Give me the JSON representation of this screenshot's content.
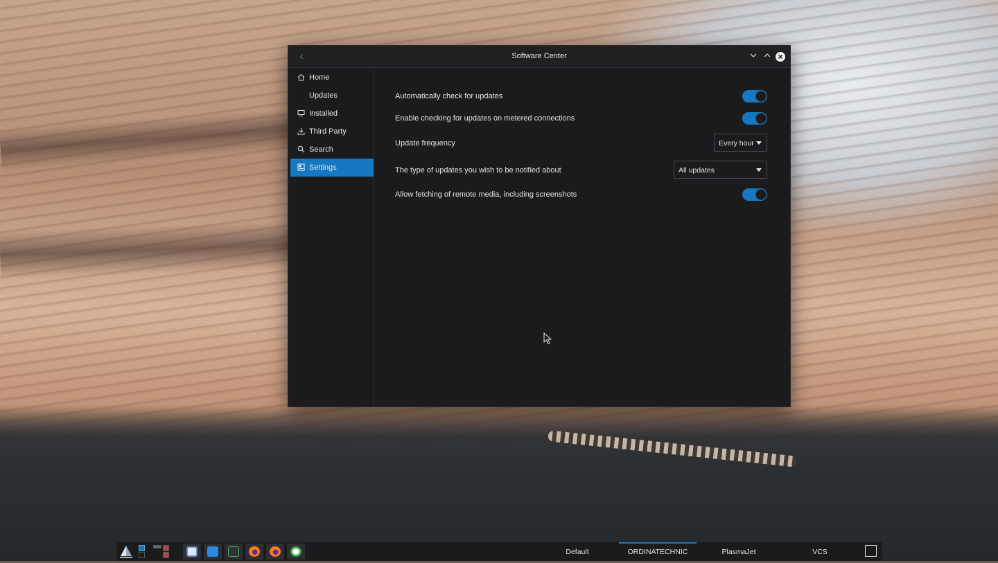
{
  "window": {
    "title": "Software Center",
    "back_icon": "chevron-left-icon",
    "controls": {
      "minimize": "chevron-down-icon",
      "maximize": "chevron-up-icon",
      "close": "close-icon"
    }
  },
  "sidebar": {
    "items": [
      {
        "label": "Home",
        "icon": "home-icon",
        "active": false
      },
      {
        "label": "Updates",
        "icon": "updates-icon",
        "active": false
      },
      {
        "label": "Installed",
        "icon": "monitor-icon",
        "active": false
      },
      {
        "label": "Third Party",
        "icon": "download-icon",
        "active": false
      },
      {
        "label": "Search",
        "icon": "search-icon",
        "active": false
      },
      {
        "label": "Settings",
        "icon": "settings-icon",
        "active": true
      }
    ]
  },
  "settings": {
    "auto_check": {
      "label": "Automatically check for updates",
      "enabled": true
    },
    "metered": {
      "label": "Enable checking for updates on metered connections",
      "enabled": true
    },
    "frequency": {
      "label": "Update frequency",
      "value": "Every hour"
    },
    "notify_type": {
      "label": "The type of updates you wish to be notified about",
      "value": "All updates"
    },
    "remote_media": {
      "label": "Allow fetching of remote media, including screenshots",
      "enabled": true
    }
  },
  "taskbar": {
    "activities": [
      {
        "label": "Default",
        "active": false
      },
      {
        "label": "ORDINATECHNIC",
        "active": true
      },
      {
        "label": "PlasmaJet",
        "active": false
      },
      {
        "label": "VCS",
        "active": false
      }
    ],
    "colors": {
      "accent": "#1677c2"
    }
  }
}
